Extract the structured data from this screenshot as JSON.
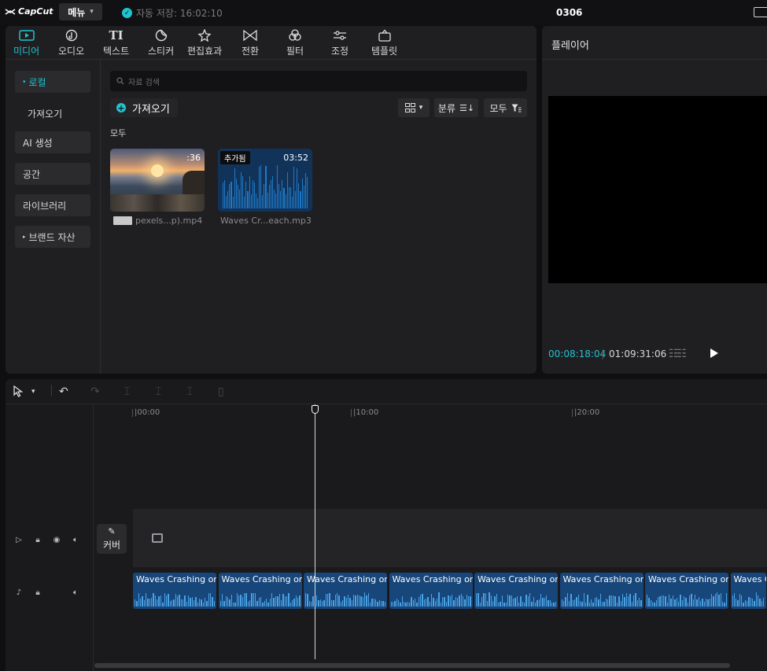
{
  "titlebar": {
    "logo": "CapCut",
    "menu_label": "메뉴",
    "autosave": "자동 저장: 16:02:10",
    "project_title": "0306"
  },
  "media": {
    "tabs": [
      {
        "label": "미디어",
        "icon": "media-icon",
        "active": true
      },
      {
        "label": "오디오",
        "icon": "audio-icon"
      },
      {
        "label": "텍스트",
        "icon": "text-icon"
      },
      {
        "label": "스티커",
        "icon": "sticker-icon"
      },
      {
        "label": "편집효과",
        "icon": "effects-icon"
      },
      {
        "label": "전환",
        "icon": "transition-icon"
      },
      {
        "label": "필터",
        "icon": "filter-icon"
      },
      {
        "label": "조정",
        "icon": "adjust-icon"
      },
      {
        "label": "템플릿",
        "icon": "template-icon"
      }
    ],
    "sidebar": [
      {
        "label": "로컬",
        "selected": true
      },
      {
        "label": "가져오기"
      },
      {
        "label": "AI 생성"
      },
      {
        "label": "공간"
      },
      {
        "label": "라이브러리"
      },
      {
        "label": "브랜드 자산"
      }
    ],
    "search_placeholder": "자료 검색",
    "import_label": "가져오기",
    "sort_label": "분류",
    "filter_label": "모두",
    "section_label": "모두",
    "items": [
      {
        "name": "pexels...p).mp4",
        "duration": ":36",
        "added": ""
      },
      {
        "name": "Waves Cr...each.mp3",
        "duration": "03:52",
        "added": "추가됨"
      }
    ]
  },
  "player": {
    "title": "플레이어",
    "current_time": "00:08:18:04",
    "total_time": "01:09:31:06"
  },
  "timeline": {
    "ruler": [
      "|00:00",
      "|10:00",
      "|20:00"
    ],
    "cover_label": "커버",
    "audio_clip_label": "Waves Crashing on",
    "audio_clip_label_cut": "Waves C"
  },
  "colors": {
    "accent": "#20c3d0",
    "audio_clip": "#17467a",
    "panel_bg": "#1f1f22"
  }
}
